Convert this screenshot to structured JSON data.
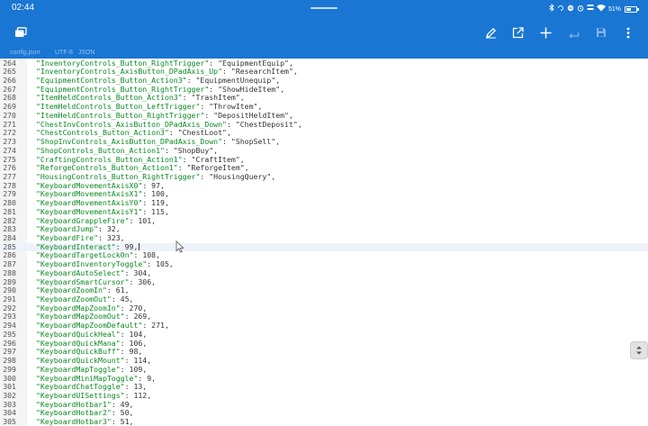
{
  "status": {
    "time": "02:44",
    "battery_text": "51%",
    "battery_level": 0.51
  },
  "toolbar": {
    "tabs_icon": "tabs-icon",
    "actions": [
      "pencil-icon",
      "open-external-icon",
      "plus-icon",
      "undo-icon",
      "save-icon",
      "more-vert-icon"
    ]
  },
  "file_tab": {
    "filename": "config.json",
    "encoding": "UTF-8",
    "language": "JSON"
  },
  "colors": {
    "primary": "#1976d2",
    "key": "#0a8a22",
    "text": "#333333",
    "line_number": "#555555"
  },
  "editor": {
    "current_line": 285,
    "lines": [
      {
        "n": "264",
        "k": "\"InventoryControls_Button_RightTrigger\"",
        "v": "\"EquipmentEquip\","
      },
      {
        "n": "265",
        "k": "\"InventoryControls_AxisButton_DPadAxis_Up\"",
        "v": "\"ResearchItem\","
      },
      {
        "n": "266",
        "k": "\"EquipmentControls_Button_Action3\"",
        "v": "\"EquipmentUnequip\","
      },
      {
        "n": "267",
        "k": "\"EquipmentControls_Button_RightTrigger\"",
        "v": "\"ShowHideItem\","
      },
      {
        "n": "268",
        "k": "\"ItemHeldControls_Button_Action3\"",
        "v": "\"TrashItem\","
      },
      {
        "n": "269",
        "k": "\"ItemHeldControls_Button_LeftTrigger\"",
        "v": "\"ThrowItem\","
      },
      {
        "n": "270",
        "k": "\"ItemHeldControls_Button_RightTrigger\"",
        "v": "\"DepositHeldItem\","
      },
      {
        "n": "271",
        "k": "\"ChestInvControls_AxisButton_DPadAxis_Down\"",
        "v": "\"ChestDeposit\","
      },
      {
        "n": "272",
        "k": "\"ChestControls_Button_Action3\"",
        "v": "\"ChestLoot\","
      },
      {
        "n": "273",
        "k": "\"ShopInvControls_AxisButton_DPadAxis_Down\"",
        "v": "\"ShopSell\","
      },
      {
        "n": "274",
        "k": "\"ShopControls_Button_Action1\"",
        "v": "\"ShopBuy\","
      },
      {
        "n": "275",
        "k": "\"CraftingControls_Button_Action1\"",
        "v": "\"CraftItem\","
      },
      {
        "n": "276",
        "k": "\"ReforgeControls_Button_Action1\"",
        "v": "\"ReforgeItem\","
      },
      {
        "n": "277",
        "k": "\"HousingControls_Button_RightTrigger\"",
        "v": "\"HousingQuery\","
      },
      {
        "n": "278",
        "k": "\"KeyboardMovementAxisX0\"",
        "v": "97,"
      },
      {
        "n": "279",
        "k": "\"KeyboardMovementAxisX1\"",
        "v": "100,"
      },
      {
        "n": "280",
        "k": "\"KeyboardMovementAxisY0\"",
        "v": "119,"
      },
      {
        "n": "281",
        "k": "\"KeyboardMovementAxisY1\"",
        "v": "115,"
      },
      {
        "n": "282",
        "k": "\"KeyboardGrappleFire\"",
        "v": "101,"
      },
      {
        "n": "283",
        "k": "\"KeyboardJump\"",
        "v": "32,"
      },
      {
        "n": "284",
        "k": "\"KeyboardFire\"",
        "v": "323,"
      },
      {
        "n": "285",
        "k": "\"KeyboardInteract\"",
        "v": "99,"
      },
      {
        "n": "286",
        "k": "\"KeyboardTargetLockOn\"",
        "v": "108,"
      },
      {
        "n": "287",
        "k": "\"KeyboardInventoryToggle\"",
        "v": "105,"
      },
      {
        "n": "288",
        "k": "\"KeyboardAutoSelect\"",
        "v": "304,"
      },
      {
        "n": "289",
        "k": "\"KeyboardSmartCursor\"",
        "v": "306,"
      },
      {
        "n": "290",
        "k": "\"KeyboardZoomIn\"",
        "v": "61,"
      },
      {
        "n": "291",
        "k": "\"KeyboardZoomOut\"",
        "v": "45,"
      },
      {
        "n": "292",
        "k": "\"KeyboardMapZoomIn\"",
        "v": "270,"
      },
      {
        "n": "293",
        "k": "\"KeyboardMapZoomOut\"",
        "v": "269,"
      },
      {
        "n": "294",
        "k": "\"KeyboardMapZoomDefault\"",
        "v": "271,"
      },
      {
        "n": "295",
        "k": "\"KeyboardQuickHeal\"",
        "v": "104,"
      },
      {
        "n": "296",
        "k": "\"KeyboardQuickMana\"",
        "v": "106,"
      },
      {
        "n": "297",
        "k": "\"KeyboardQuickBuff\"",
        "v": "98,"
      },
      {
        "n": "298",
        "k": "\"KeyboardQuickMount\"",
        "v": "114,"
      },
      {
        "n": "299",
        "k": "\"KeyboardMapToggle\"",
        "v": "109,"
      },
      {
        "n": "300",
        "k": "\"KeyboardMiniMapToggle\"",
        "v": "9,"
      },
      {
        "n": "301",
        "k": "\"KeyboardChatToggle\"",
        "v": "13,"
      },
      {
        "n": "302",
        "k": "\"KeyboardUISettings\"",
        "v": "112,"
      },
      {
        "n": "303",
        "k": "\"KeyboardHotbar1\"",
        "v": "49,"
      },
      {
        "n": "304",
        "k": "\"KeyboardHotbar2\"",
        "v": "50,"
      },
      {
        "n": "305",
        "k": "\"KeyboardHotbar3\"",
        "v": "51,"
      }
    ]
  }
}
